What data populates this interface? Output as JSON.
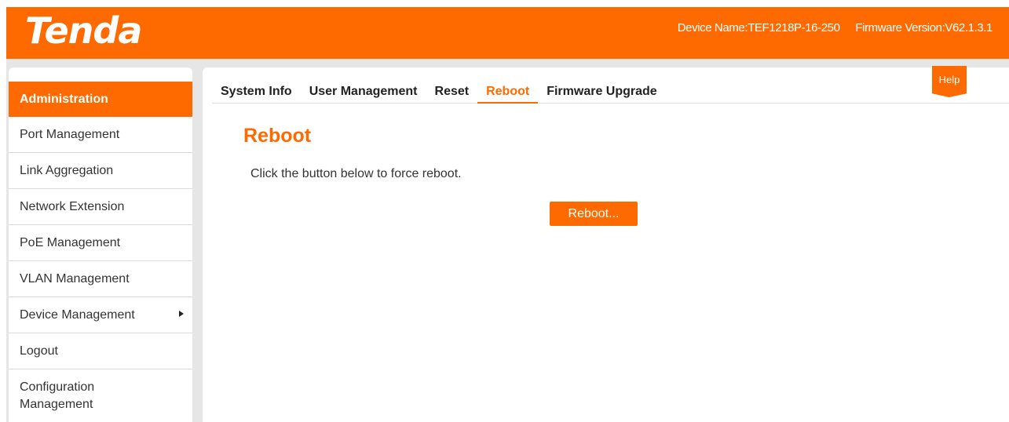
{
  "header": {
    "logo": "Tenda",
    "device_name": "Device Name:TEF1218P-16-250",
    "firmware_version": "Firmware Version:V62.1.3.1"
  },
  "sidebar": {
    "section_title": "Administration",
    "items": [
      {
        "label": "Port Management"
      },
      {
        "label": "Link Aggregation"
      },
      {
        "label": "Network Extension"
      },
      {
        "label": "PoE Management"
      },
      {
        "label": "VLAN Management"
      },
      {
        "label": "Device Management",
        "icon": "arrow-right-icon"
      },
      {
        "label": "Logout"
      },
      {
        "label": "Configuration Management"
      }
    ]
  },
  "tabs": [
    {
      "label": "System Info"
    },
    {
      "label": "User Management"
    },
    {
      "label": "Reset"
    },
    {
      "label": "Reboot",
      "active": true
    },
    {
      "label": "Firmware Upgrade"
    }
  ],
  "help": {
    "label": "Help"
  },
  "main": {
    "title": "Reboot",
    "description": "Click the button below to force reboot.",
    "button_label": "Reboot..."
  },
  "colors": {
    "accent": "#ff6a00",
    "background": "#e6e6e6"
  }
}
